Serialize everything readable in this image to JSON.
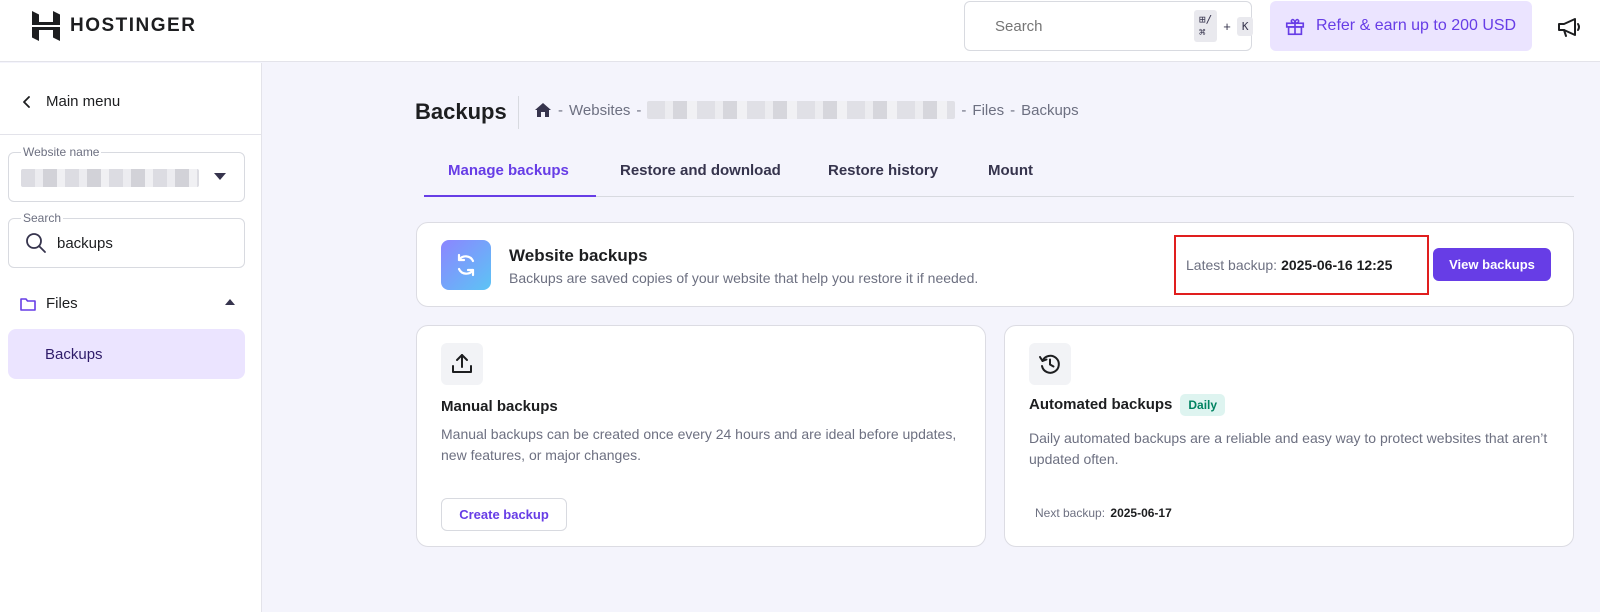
{
  "brand": {
    "name": "HOSTINGER",
    "accent": "#673de6"
  },
  "header": {
    "search_placeholder": "Search",
    "shortcut_modifier": "⊞/⌘",
    "shortcut_plus": "+",
    "shortcut_key": "K",
    "refer_label": "Refer & earn up to 200 USD"
  },
  "sidebar": {
    "main_menu_label": "Main menu",
    "website_name_label": "Website name",
    "search_label": "Search",
    "search_value": "backups",
    "section_label": "Files",
    "active_item_label": "Backups"
  },
  "page": {
    "title": "Backups",
    "breadcrumb": {
      "sep1": "-",
      "websites": "Websites",
      "sep2": "-",
      "sep3": "-",
      "files": "Files",
      "sep4": "-",
      "current": "Backups"
    },
    "tabs": [
      {
        "label": "Manage backups",
        "active": true
      },
      {
        "label": "Restore and download",
        "active": false
      },
      {
        "label": "Restore history",
        "active": false
      },
      {
        "label": "Mount",
        "active": false
      }
    ]
  },
  "website_backups": {
    "title": "Website backups",
    "description": "Backups are saved copies of your website that help you restore it if needed.",
    "latest_label": "Latest backup:",
    "latest_value": "2025-06-16 12:25",
    "view_button": "View backups"
  },
  "manual_backups": {
    "title": "Manual backups",
    "description": "Manual backups can be created once every 24 hours and are ideal before updates, new features, or major changes.",
    "button": "Create backup"
  },
  "automated_backups": {
    "title": "Automated backups",
    "badge": "Daily",
    "description": "Daily automated backups are a reliable and easy way to protect websites that aren’t updated often.",
    "next_label": "Next backup:",
    "next_value": "2025-06-17"
  }
}
